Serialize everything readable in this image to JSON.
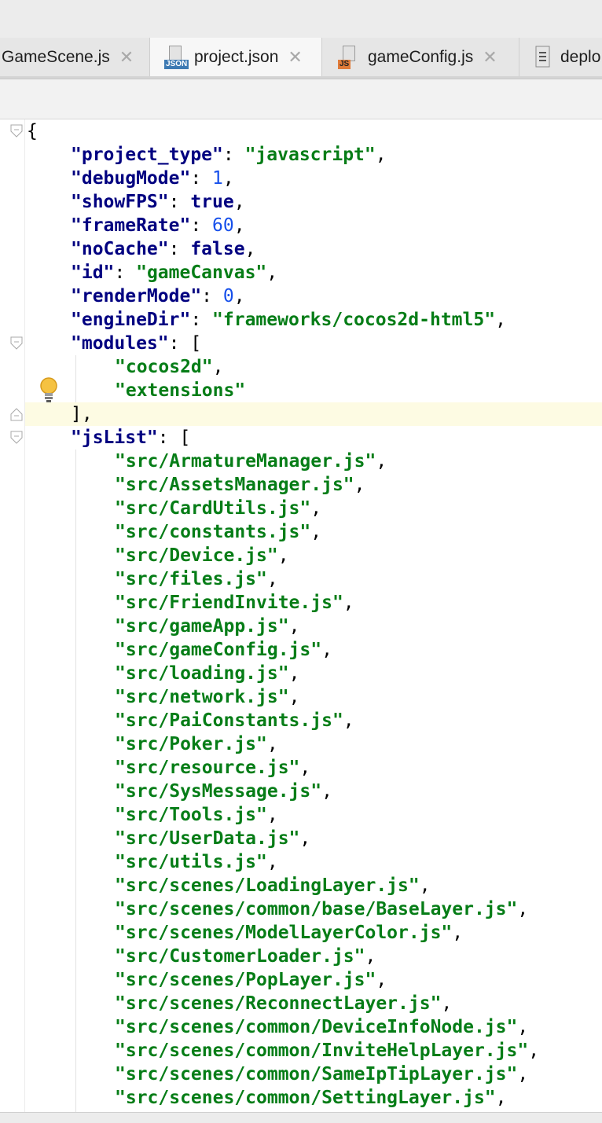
{
  "tabs": [
    {
      "label": "GameScene.js",
      "icon": "js-file-icon",
      "active": false
    },
    {
      "label": "project.json",
      "icon": "json-file-icon",
      "badge": "JSON",
      "active": true
    },
    {
      "label": "gameConfig.js",
      "icon": "js-file-icon",
      "badge": "JS",
      "active": false
    },
    {
      "label": "deplo",
      "icon": "text-file-icon",
      "active": false
    }
  ],
  "close_glyph": "✕",
  "colors": {
    "key": "#000080",
    "string": "#067d17",
    "number": "#1750eb",
    "highlight_line": "#fdfbe3"
  },
  "editor": {
    "caret_line_icon": "lightbulb-icon",
    "lines": {
      "l1": "{",
      "l2k": "\"project_type\"",
      "l2v": "\"javascript\"",
      "l3k": "\"debugMode\"",
      "l3v": "1",
      "l4k": "\"showFPS\"",
      "l4v": "true",
      "l5k": "\"frameRate\"",
      "l5v": "60",
      "l6k": "\"noCache\"",
      "l6v": "false",
      "l7k": "\"id\"",
      "l7v": "\"gameCanvas\"",
      "l8k": "\"renderMode\"",
      "l8v": "0",
      "l9k": "\"engineDir\"",
      "l9v": "\"frameworks/cocos2d-html5\"",
      "l10k": "\"modules\"",
      "l10v": "[",
      "l11": "\"cocos2d\"",
      "l12": "\"extensions\"",
      "l13": "],",
      "l14k": "\"jsList\"",
      "l14v": "["
    },
    "jsList": [
      "\"src/ArmatureManager.js\"",
      "\"src/AssetsManager.js\"",
      "\"src/CardUtils.js\"",
      "\"src/constants.js\"",
      "\"src/Device.js\"",
      "\"src/files.js\"",
      "\"src/FriendInvite.js\"",
      "\"src/gameApp.js\"",
      "\"src/gameConfig.js\"",
      "\"src/loading.js\"",
      "\"src/network.js\"",
      "\"src/PaiConstants.js\"",
      "\"src/Poker.js\"",
      "\"src/resource.js\"",
      "\"src/SysMessage.js\"",
      "\"src/Tools.js\"",
      "\"src/UserData.js\"",
      "\"src/utils.js\"",
      "\"src/scenes/LoadingLayer.js\"",
      "\"src/scenes/common/base/BaseLayer.js\"",
      "\"src/scenes/ModelLayerColor.js\"",
      "\"src/CustomerLoader.js\"",
      "\"src/scenes/PopLayer.js\"",
      "\"src/scenes/ReconnectLayer.js\"",
      "\"src/scenes/common/DeviceInfoNode.js\"",
      "\"src/scenes/common/InviteHelpLayer.js\"",
      "\"src/scenes/common/SameIpTipLayer.js\"",
      "\"src/scenes/common/SettingLayer.js\""
    ]
  }
}
